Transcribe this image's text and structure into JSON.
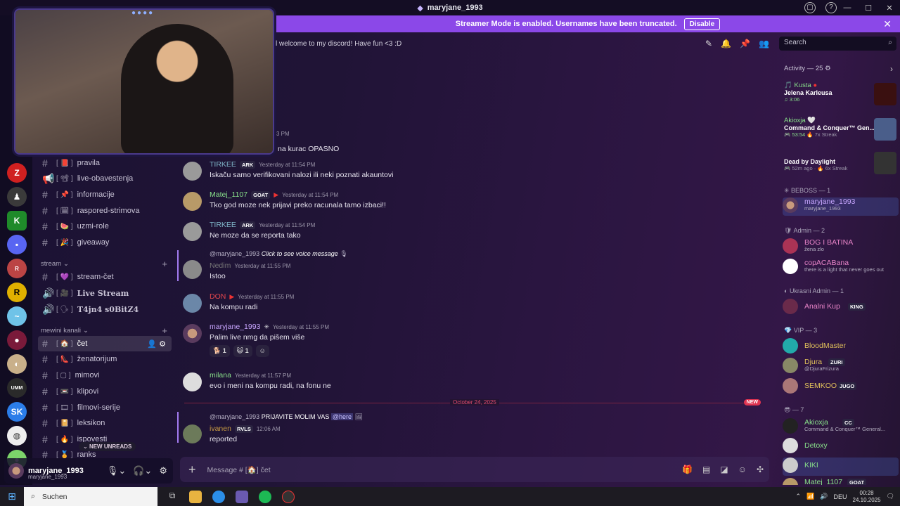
{
  "window": {
    "title": "maryjane_1993"
  },
  "banner": {
    "text": "Streamer Mode is enabled. Usernames have been truncated.",
    "button": "Disable"
  },
  "topic": "l welcome to my discord! Have fun <3 :D",
  "search": {
    "placeholder": "Search"
  },
  "channels": [
    {
      "name": "pravila",
      "type": "#"
    },
    {
      "name": "live-obavestenja",
      "type": "announce"
    },
    {
      "name": "informacije",
      "type": "#"
    },
    {
      "name": "raspored-strimova",
      "type": "#"
    },
    {
      "name": "uzmi-role",
      "type": "#"
    },
    {
      "name": "giveaway",
      "type": "#"
    }
  ],
  "cat_stream": "stream",
  "stream_channels": [
    {
      "name": "stream-čet",
      "type": "#"
    },
    {
      "name": "Live Stream",
      "type": "voice"
    },
    {
      "name": "T4jn4 s0BitZ4",
      "type": "voice"
    }
  ],
  "cat_mewini": "mewini kanali",
  "mewini_channels": [
    {
      "name": "čet",
      "type": "#"
    },
    {
      "name": "ženatorijum",
      "type": "#"
    },
    {
      "name": "mimovi",
      "type": "#"
    },
    {
      "name": "klipovi",
      "type": "#"
    },
    {
      "name": "filmovi-serije",
      "type": "#"
    },
    {
      "name": "leksikon",
      "type": "#"
    },
    {
      "name": "ispovesti",
      "type": "#"
    },
    {
      "name": "ranks",
      "type": "#"
    }
  ],
  "new_unreads": "NEW UNREADS",
  "user": {
    "name": "maryjane_1993",
    "sub": "maryjane_1993"
  },
  "messages": [
    {
      "time_partial": "3 PM",
      "text": "na kurac OPASNO"
    },
    {
      "author": "TIRKEE",
      "tag": "ARK",
      "time": "Yesterday at 11:54 PM",
      "text": "Iskaču samo verifikovani nalozi ili neki poznati akauntovi"
    },
    {
      "author": "Matej_1107",
      "tag": "GOAT",
      "time": "Yesterday at 11:54 PM",
      "text": "Tko god moze nek prijavi preko racunala tamo izbaci!!"
    },
    {
      "author": "TIRKEE",
      "tag": "ARK",
      "time": "Yesterday at 11:54 PM",
      "text": "Ne moze da se reporta tako"
    },
    {
      "reply": "@maryjane_1993",
      "reply_text": "Click to see voice message",
      "author": "Nedim",
      "time": "Yesterday at 11:55 PM",
      "text": "Istoo"
    },
    {
      "author": "DON",
      "time": "Yesterday at 11:55 PM",
      "text": "Na kompu radi"
    },
    {
      "author": "maryjane_1993",
      "time": "Yesterday at 11:55 PM",
      "text": "Palim live nmg da pišem više",
      "reactions": [
        "1",
        "1"
      ]
    },
    {
      "author": "milana",
      "time": "Yesterday at 11:57 PM",
      "text": "evo i meni na kompu radi, na fonu ne"
    },
    {
      "reply": "@maryjane_1993",
      "reply_text": "PRIJAVITE MOLIM VAS",
      "reply_mention": "@here",
      "author": "ivanen",
      "tag": "RVLS",
      "time": "12:06 AM",
      "text": "reported"
    }
  ],
  "divider": {
    "label": "October 24, 2025",
    "new": "NEW"
  },
  "composer": {
    "placeholder": "Message # [🏠] čet"
  },
  "activity": {
    "header": "Activity — 25",
    "items": [
      {
        "user": "Kusta",
        "game": "Jelena Karleusa",
        "meta": "3:06"
      },
      {
        "user": "Akioxja",
        "game": "Command & Conquer™ Gen...",
        "meta": "53:54",
        "meta2": "7x Streak"
      },
      {
        "user": "",
        "game": "Dead by Daylight",
        "meta": "52m ago",
        "meta2": "6x Streak"
      }
    ]
  },
  "members": {
    "beboss": "BEBOSS — 1",
    "admin": "Admin — 2",
    "ukrasni": "Ukrasni Admin — 1",
    "vip": "VIP — 3",
    "other": "— 7",
    "list": [
      {
        "name": "maryjane_1993",
        "sub": "maryjane_1993",
        "color": "#c8a6ff"
      },
      {
        "name": "BOG I BATINA",
        "sub": "žena zlo",
        "color": "#e884c8"
      },
      {
        "name": "copACABana",
        "sub": "there is a light that never goes out",
        "color": "#e884c8"
      },
      {
        "name": "Analni Kup",
        "tag": "KING",
        "color": "#e884c8"
      },
      {
        "name": "BloodMaster",
        "color": "#e0c05a"
      },
      {
        "name": "Djura",
        "sub": "@DjuraFrizura",
        "tag": "ZURI",
        "color": "#e0c05a"
      },
      {
        "name": "SEMKOO",
        "tag": "JUGO",
        "color": "#e0c05a"
      },
      {
        "name": "Akioxja",
        "sub": "Command & Conquer™ General...",
        "tag": "CC",
        "color": "#88e08a"
      },
      {
        "name": "Detoxy",
        "color": "#88e08a"
      },
      {
        "name": "KIKI",
        "color": "#88e08a"
      },
      {
        "name": "Matej_1107",
        "tag": "GOAT",
        "color": "#88e08a"
      }
    ]
  },
  "taskbar": {
    "search": "Suchen",
    "lang": "DEU",
    "time": "00:28",
    "date": "24.10.2025"
  },
  "colors": {
    "banner": "#8b48e8",
    "accent": "#5865f2"
  }
}
